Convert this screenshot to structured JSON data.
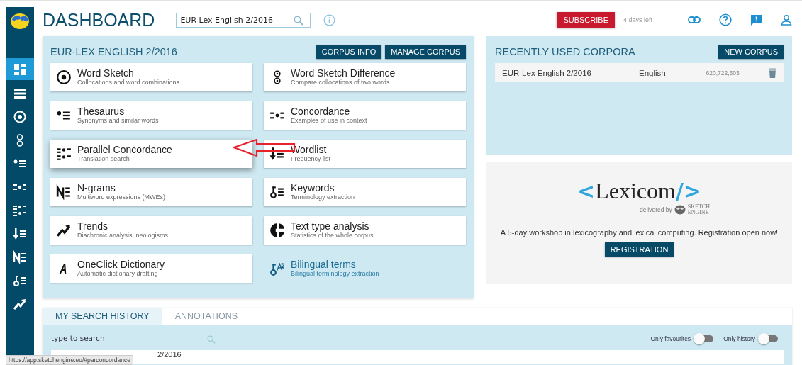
{
  "header": {
    "title": "DASHBOARD",
    "corpus_search": {
      "value": "EUR-Lex English 2/2016"
    },
    "subscribe": "SUBSCRIBE",
    "trial": "4 days left"
  },
  "sidebar": {
    "items": [
      {
        "kind": "dashboard",
        "selected": true
      },
      {
        "kind": "list",
        "selected": false
      },
      {
        "kind": "wordsketch",
        "selected": false
      },
      {
        "kind": "wsdiff",
        "selected": false
      },
      {
        "kind": "thesaurus",
        "selected": false
      },
      {
        "kind": "concordance",
        "selected": false
      },
      {
        "kind": "parallel",
        "selected": false
      },
      {
        "kind": "wordlist",
        "selected": false
      },
      {
        "kind": "ngrams",
        "selected": false
      },
      {
        "kind": "keywords",
        "selected": false
      },
      {
        "kind": "trends",
        "selected": false
      }
    ]
  },
  "corpus_panel": {
    "title": "EUR-LEX ENGLISH 2/2016",
    "buttons": [
      "CORPUS INFO",
      "MANAGE CORPUS"
    ],
    "tools": [
      {
        "kind": "wordsketch",
        "name": "Word Sketch",
        "description": "Collocations and word combinations",
        "available": true,
        "hovered": false
      },
      {
        "kind": "wsdiff",
        "name": "Word Sketch Difference",
        "description": "Compare collocations of two words",
        "available": true,
        "hovered": false
      },
      {
        "kind": "thesaurus",
        "name": "Thesaurus",
        "description": "Synonyms and similar words",
        "available": true,
        "hovered": false
      },
      {
        "kind": "concordance",
        "name": "Concordance",
        "description": "Examples of use in context",
        "available": true,
        "hovered": false
      },
      {
        "kind": "parallel",
        "name": "Parallel Concordance",
        "description": "Translation search",
        "available": true,
        "hovered": true
      },
      {
        "kind": "wordlist",
        "name": "Wordlist",
        "description": "Frequency list",
        "available": true,
        "hovered": false
      },
      {
        "kind": "ngrams",
        "name": "N-grams",
        "description": "Multiword expressions (MWEs)",
        "available": true,
        "hovered": false
      },
      {
        "kind": "keywords",
        "name": "Keywords",
        "description": "Terminology extraction",
        "available": true,
        "hovered": false
      },
      {
        "kind": "trends",
        "name": "Trends",
        "description": "Diachronic analysis, neologisms",
        "available": true,
        "hovered": false
      },
      {
        "kind": "texttype",
        "name": "Text type analysis",
        "description": "Statistics of the whole corpus",
        "available": true,
        "hovered": false
      },
      {
        "kind": "oneclick",
        "name": "OneClick Dictionary",
        "description": "Automatic dictionary drafting",
        "available": true,
        "hovered": false
      },
      {
        "kind": "bilingual",
        "name": "Bilingual terms",
        "description": "Bilingual terminology extraction",
        "available": false,
        "hovered": false
      }
    ]
  },
  "recent_corpora": {
    "title": "RECENTLY USED CORPORA",
    "button": "NEW CORPUS",
    "rows": [
      {
        "name": "EUR-Lex English 2/2016",
        "language": "English",
        "size": "620,722,503"
      }
    ]
  },
  "promo": {
    "logo_left": "<",
    "logo_word": "Lexicom",
    "logo_right": "/>",
    "delivered_by": "delivered by",
    "brand_line_1": "SKETCH",
    "brand_line_2": "ENGINE",
    "text": "A 5-day workshop in lexicography and lexical computing. Registration open now!",
    "button": "REGISTRATION"
  },
  "history": {
    "tabs": [
      {
        "label": "MY SEARCH HISTORY",
        "selected": true
      },
      {
        "label": "ANNOTATIONS",
        "selected": false
      }
    ],
    "search": {
      "placeholder": "type to search"
    },
    "toggles": [
      {
        "label": "Only favourites",
        "on": false
      },
      {
        "label": "Only history",
        "on": false
      }
    ],
    "first_row": "2/2016"
  },
  "status_url": "https://app.sketchengine.eu/#parconcordance"
}
